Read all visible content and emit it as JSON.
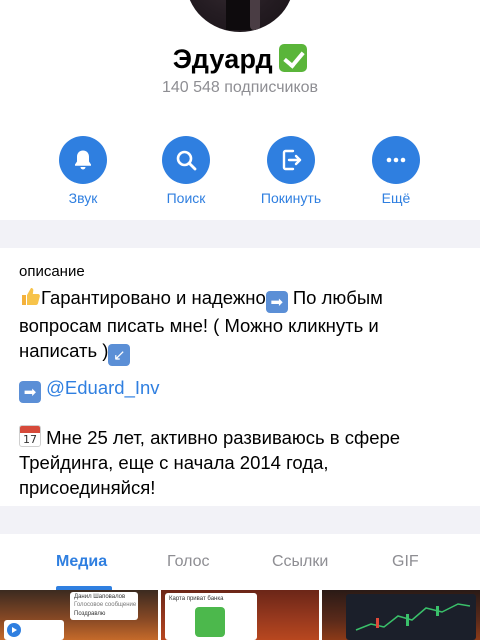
{
  "profile": {
    "name": "Эдуард",
    "verified_icon": "verified-check-icon",
    "subscribers": "140 548 подписчиков"
  },
  "actions": [
    {
      "label": "Звук",
      "icon": "bell-icon"
    },
    {
      "label": "Поиск",
      "icon": "search-icon"
    },
    {
      "label": "Покинуть",
      "icon": "leave-icon"
    },
    {
      "label": "Ещё",
      "icon": "more-icon"
    }
  ],
  "description": {
    "title": "описание",
    "line1_a": "Гарантировано и надежно",
    "line1_b": " По любым",
    "line2": "вопросам писать мне! ( Можно кликнуть и",
    "line3": "написать )",
    "link": "@Eduard_Inv",
    "cal_day": "17",
    "para3_line1": "Мне 25 лет, активно развиваюсь в сфере",
    "para3_line2": "Трейдинга, еще с начала 2014 года,",
    "para3_line3": "присоединяйся!"
  },
  "tabs": [
    {
      "label": "Медиа",
      "active": true
    },
    {
      "label": "Голос",
      "active": false
    },
    {
      "label": "Ссылки",
      "active": false
    },
    {
      "label": "GIF",
      "active": false
    }
  ],
  "media": {
    "t1_line1": "Данил Шаповалов",
    "t1_line2": "Голосовое сообщение",
    "t1_line3": "Поздравлю",
    "t2_title": "Карта приват банка"
  },
  "colors": {
    "accent": "#2f7fe0",
    "verified": "#5ab53a",
    "secondary_text": "#8e8e93"
  }
}
